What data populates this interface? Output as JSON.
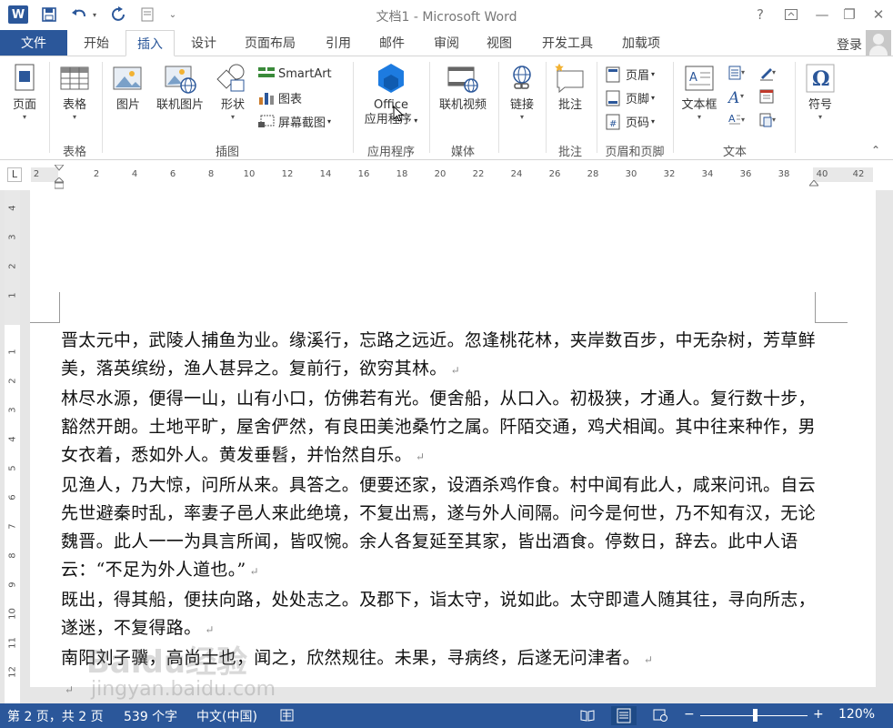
{
  "titlebar": {
    "title": "文档1 - Microsoft Word",
    "help": "?",
    "minimize": "—",
    "restore": "❐",
    "close": "✕"
  },
  "tabs": {
    "file": "文件",
    "items": [
      "开始",
      "插入",
      "设计",
      "页面布局",
      "引用",
      "邮件",
      "审阅",
      "视图",
      "开发工具",
      "加载项"
    ],
    "active": "插入",
    "login": "登录"
  },
  "ribbon": {
    "groups": {
      "pages": "表格",
      "illustrations": "插图",
      "apps": "应用程序",
      "media": "媒体",
      "comments": "批注",
      "header_footer": "页眉和页脚",
      "text": "文本"
    },
    "buttons": {
      "page": "页面",
      "table": "表格",
      "picture": "图片",
      "online_picture": "联机图片",
      "shapes": "形状",
      "smartart": "SmartArt",
      "chart": "图表",
      "screenshot": "屏幕截图",
      "office_line1": "Office",
      "office_line2": "应用程序",
      "online_video": "联机视频",
      "link": "链接",
      "comment": "批注",
      "header": "页眉",
      "footer": "页脚",
      "page_number": "页码",
      "textbox": "文本框",
      "symbol": "符号"
    }
  },
  "ruler": {
    "corner": "L",
    "h_numbers": [
      "2",
      "2",
      "4",
      "6",
      "8",
      "10",
      "12",
      "14",
      "16",
      "18",
      "20",
      "22",
      "24",
      "26",
      "28",
      "30",
      "32",
      "34",
      "36",
      "38",
      "40",
      "42"
    ],
    "v_numbers_top": [
      "4",
      "3",
      "2",
      "1"
    ],
    "v_numbers_body": [
      "1",
      "2",
      "3",
      "4",
      "5",
      "6",
      "7",
      "8",
      "9",
      "10",
      "11",
      "12"
    ]
  },
  "document": {
    "paragraphs": [
      "晋太元中，武陵人捕鱼为业。缘溪行，忘路之远近。忽逢桃花林，夹岸数百步，中无杂树，芳草鲜美，落英缤纷，渔人甚异之。复前行，欲穷其林。",
      "林尽水源，便得一山，山有小口，仿佛若有光。便舍船，从口入。初极狭，才通人。复行数十步，豁然开朗。土地平旷，屋舍俨然，有良田美池桑竹之属。阡陌交通，鸡犬相闻。其中往来种作，男女衣着，悉如外人。黄发垂髫，并怡然自乐。",
      "见渔人，乃大惊，问所从来。具答之。便要还家，设酒杀鸡作食。村中闻有此人，咸来问讯。自云先世避秦时乱，率妻子邑人来此绝境，不复出焉，遂与外人间隔。问今是何世，乃不知有汉，无论魏晋。此人一一为具言所闻，皆叹惋。余人各复延至其家，皆出酒食。停数日，辞去。此中人语云：“不足为外人道也。”",
      "既出，得其船，便扶向路，处处志之。及郡下，诣太守，说如此。太守即遣人随其往，寻向所志，遂迷，不复得路。",
      "南阳刘子骥，高尚士也，闻之，欣然规往。未果，寻病终，后遂无问津者。",
      ""
    ],
    "paragraph_mark": "↵"
  },
  "statusbar": {
    "page": "第 2 页，共 2 页",
    "words": "539 个字",
    "language": "中文(中国)",
    "zoom_minus": "−",
    "zoom_plus": "+",
    "zoom": "120%"
  },
  "watermark": {
    "text": "Baidu经验",
    "url": "jingyan.baidu.com"
  },
  "colors": {
    "accent": "#2b579a",
    "status_bar": "#2b579a"
  }
}
